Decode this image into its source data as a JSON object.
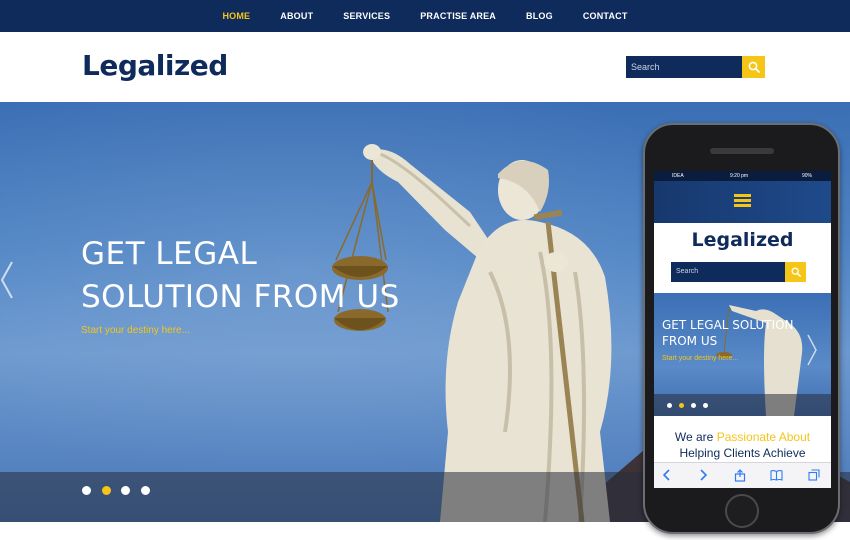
{
  "nav": {
    "items": [
      {
        "label": "HOME",
        "active": true
      },
      {
        "label": "ABOUT",
        "active": false
      },
      {
        "label": "SERVICES",
        "active": false
      },
      {
        "label": "PRACTISE AREA",
        "active": false
      },
      {
        "label": "BLOG",
        "active": false
      },
      {
        "label": "CONTACT",
        "active": false
      }
    ]
  },
  "header": {
    "logo": "Legalized",
    "search_placeholder": "Search",
    "search_icon": "search-icon"
  },
  "hero": {
    "title_line1": "GET LEGAL",
    "title_line2": "SOLUTION FROM US",
    "subtitle": "Start your destiny here...",
    "slide_count": 4,
    "active_slide": 2
  },
  "phone": {
    "status": {
      "carrier": "IDEA",
      "time": "9:20 pm",
      "battery": "90%"
    },
    "logo": "Legalized",
    "search_placeholder": "Search",
    "hero_title": "GET LEGAL SOLUTION FROM US",
    "hero_subtitle": "Start your destiny here...",
    "about_prefix": "We are ",
    "about_highlight": "Passionate About",
    "about_line2": "Helping Clients Achieve",
    "toolbar_icons": [
      "back-icon",
      "forward-icon",
      "share-icon",
      "bookmarks-icon",
      "tabs-icon"
    ]
  },
  "colors": {
    "brand_navy": "#0f2b5b",
    "accent_yellow": "#f5c518",
    "white": "#ffffff"
  }
}
